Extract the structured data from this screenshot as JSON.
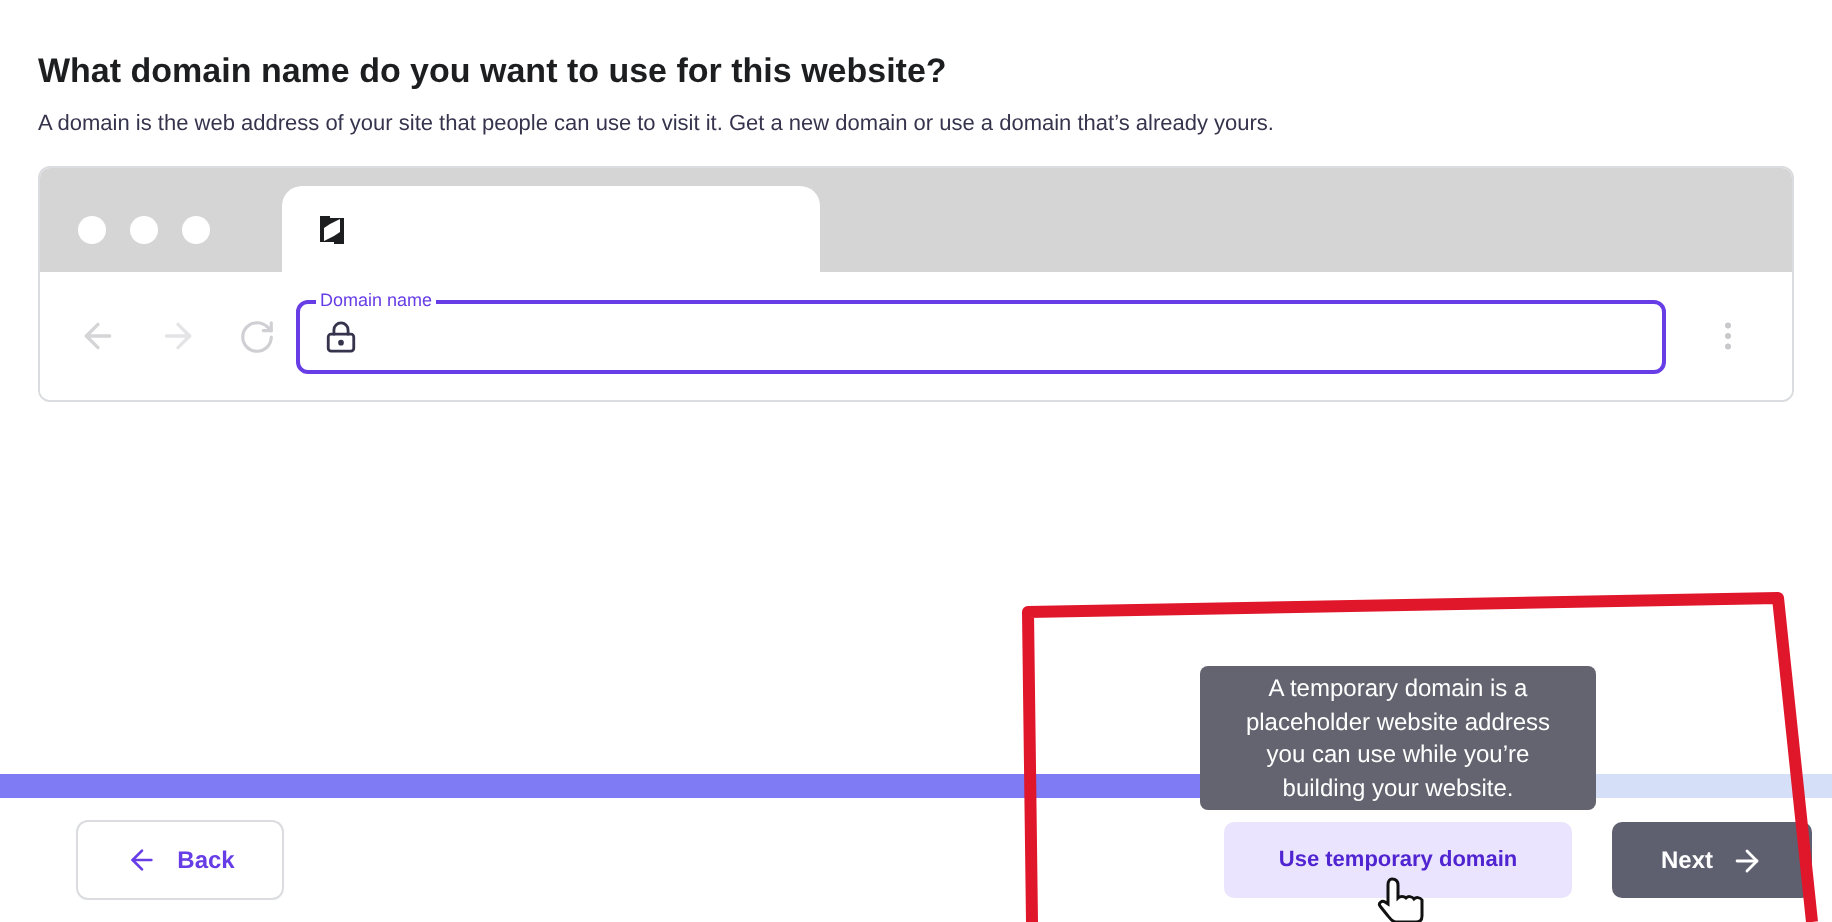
{
  "heading": "What domain name do you want to use for this website?",
  "description": "A domain is the web address of your site that people can use to visit it. Get a new domain or use a domain that’s already yours.",
  "browser": {
    "field_label": "Domain name"
  },
  "progress": {
    "level": 0.7
  },
  "footer": {
    "back": "Back",
    "temporary": "Use temporary domain",
    "next": "Next"
  },
  "tooltip": "A temporary domain is a placeholder website address you can use while you’re building your website."
}
